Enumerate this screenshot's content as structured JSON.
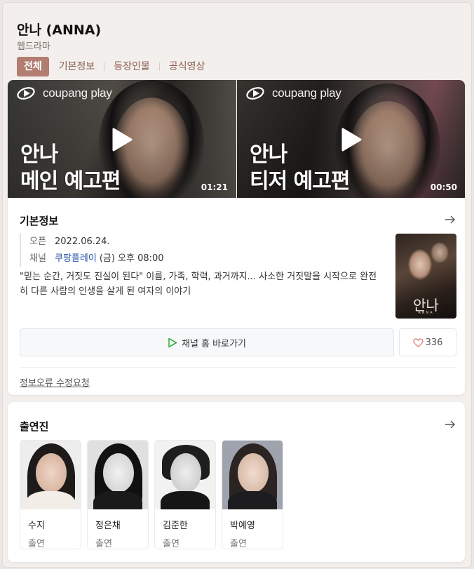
{
  "header": {
    "title": "안나 (ANNA)",
    "subtitle": "웹드라마",
    "tabs": [
      {
        "label": "전체",
        "active": true
      },
      {
        "label": "기본정보",
        "active": false
      },
      {
        "label": "등장인물",
        "active": false
      },
      {
        "label": "공식영상",
        "active": false
      }
    ]
  },
  "videos": [
    {
      "brand": "coupang play",
      "title_line1": "안나",
      "title_line2": "메인 예고편",
      "duration": "01:21",
      "icon": "play-icon"
    },
    {
      "brand": "coupang play",
      "title_line1": "안나",
      "title_line2": "티저 예고편",
      "duration": "00:50",
      "icon": "play-icon"
    }
  ],
  "basic_info": {
    "title": "기본정보",
    "open_label": "오픈",
    "open_value": "2022.06.24.",
    "channel_label": "채널",
    "channel_link": "쿠팡플레이",
    "channel_schedule": "(금) 오후 08:00",
    "description": "\"믿는 순간, 거짓도 진실이 된다\" 이름, 가족, 학력, 과거까지... 사소한 거짓말을 시작으로 완전히 다른 사람의 인생을 살게 된 여자의 이야기",
    "poster_title": "안나",
    "poster_subtitle": "ANNA",
    "channel_button": "채널 홈 바로가기",
    "like_count": "336",
    "report_link": "정보오류 수정요청"
  },
  "cast": {
    "title": "출연진",
    "members": [
      {
        "name": "수지",
        "role": "출연"
      },
      {
        "name": "정은채",
        "role": "출연"
      },
      {
        "name": "김준한",
        "role": "출연"
      },
      {
        "name": "박예영",
        "role": "출연"
      }
    ]
  },
  "colors": {
    "accent": "#b27e72",
    "tab_text": "#8b5f4f",
    "link": "#2450a6",
    "play_green": "#3cb046",
    "heart": "#e27a7a"
  }
}
